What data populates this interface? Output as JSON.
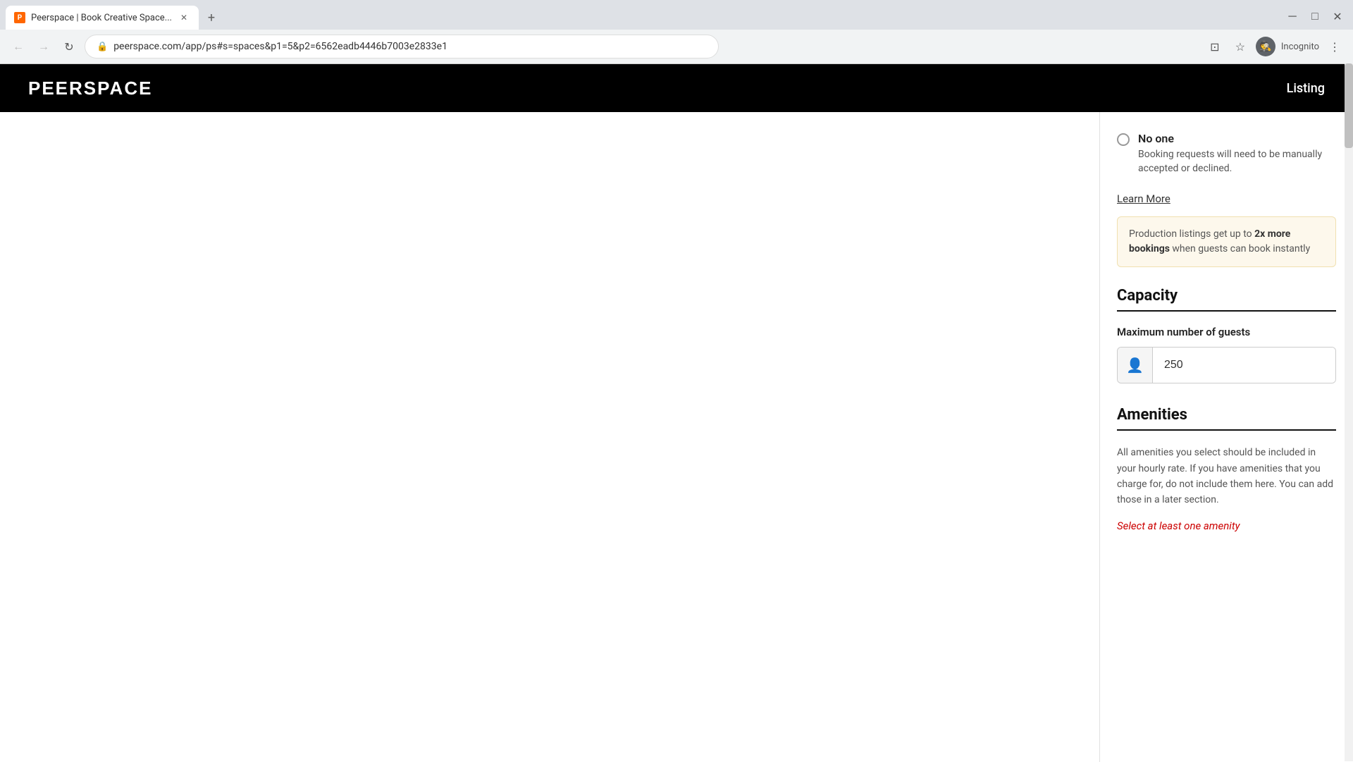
{
  "browser": {
    "tab_title": "Peerspace | Book Creative Space...",
    "tab_favicon": "P",
    "url": "peerspace.com/app/ps#s=spaces&p1=5&p2=6562eadb4446b7003e2833e1",
    "new_tab_label": "+",
    "nav": {
      "back_icon": "←",
      "forward_icon": "→",
      "reload_icon": "↻",
      "lock_icon": "🔒"
    },
    "controls": {
      "cast_icon": "⊡",
      "star_icon": "☆",
      "profile_icon": "👤",
      "incognito_label": "Incognito",
      "more_icon": "⋮"
    }
  },
  "header": {
    "logo": "PEERSPACE",
    "nav_link": "Listing"
  },
  "form": {
    "no_one_section": {
      "title": "No one",
      "description": "Booking requests will need to be manually accepted or declined."
    },
    "learn_more_link": "Learn More",
    "promo_box": {
      "text_start": "Production listings get up to ",
      "highlight": "2x more bookings",
      "text_end": " when guests can book instantly"
    },
    "capacity_section": {
      "title": "Capacity",
      "max_guests_label": "Maximum number of guests",
      "max_guests_value": "250",
      "max_guests_placeholder": "250",
      "person_icon": "👤"
    },
    "amenities_section": {
      "title": "Amenities",
      "description": "All amenities you select should be included in your hourly rate. If you have amenities that you charge for, do not include them here. You can add those in a later section.",
      "error_message": "Select at least one amenity"
    }
  }
}
